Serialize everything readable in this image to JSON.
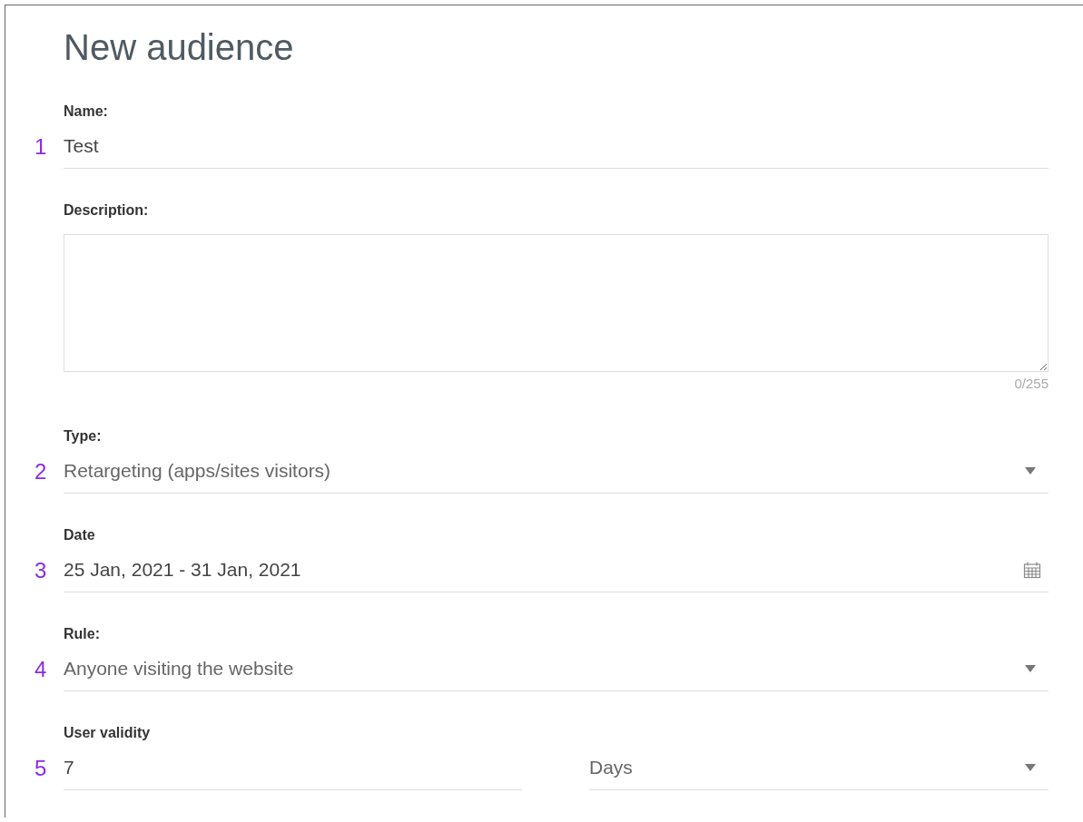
{
  "title": "New audience",
  "fields": [
    {
      "kind": "text",
      "marker": "1",
      "label": "Name:",
      "value": "Test"
    },
    {
      "kind": "textarea",
      "label": "Description:",
      "counter": "0/255"
    },
    {
      "kind": "select",
      "marker": "2",
      "label": "Type:",
      "value": "Retargeting (apps/sites visitors)"
    },
    {
      "kind": "date",
      "marker": "3",
      "label": "Date",
      "value": "25 Jan, 2021 - 31 Jan, 2021"
    },
    {
      "kind": "select",
      "marker": "4",
      "label": "Rule:",
      "value": "Anyone visiting the website"
    },
    {
      "kind": "split",
      "marker": "5",
      "label": "User validity",
      "value": "7",
      "unit": "Days"
    }
  ]
}
